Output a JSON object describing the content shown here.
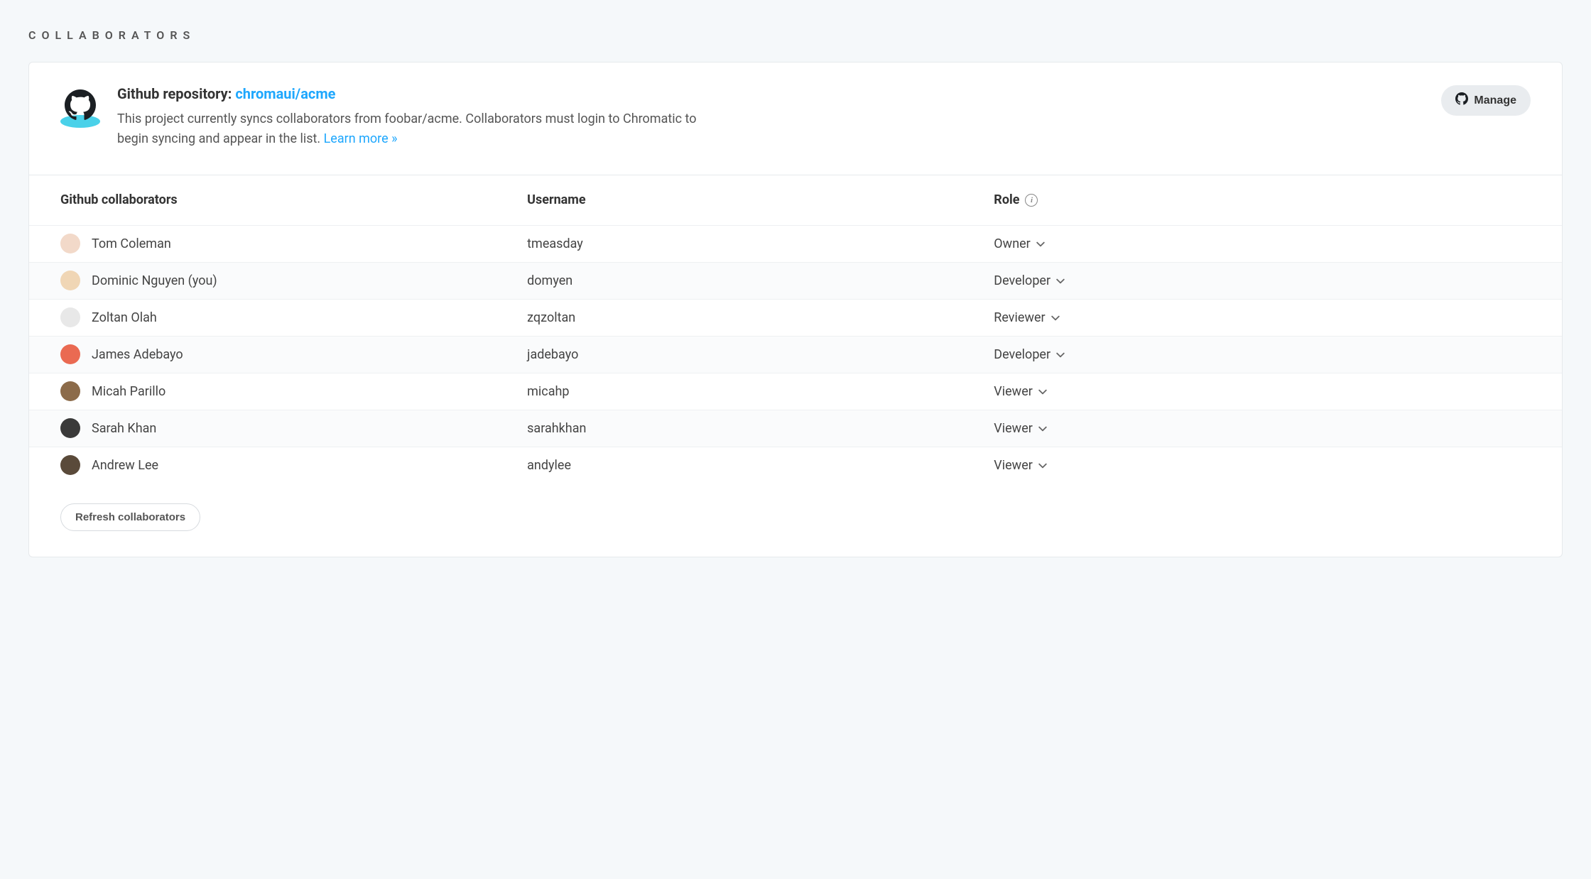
{
  "section_title": "Collaborators",
  "header": {
    "title_prefix": "Github repository: ",
    "repo_link_text": "chromaui/acme",
    "description_before_link": "This project currently syncs collaborators from foobar/acme. Collaborators must login to Chromatic to begin syncing and appear in the list. ",
    "learn_more_text": "Learn more »",
    "manage_button_label": "Manage"
  },
  "table": {
    "columns": {
      "name": "Github collaborators",
      "username": "Username",
      "role": "Role"
    },
    "rows": [
      {
        "name": "Tom Coleman",
        "username": "tmeasday",
        "role": "Owner",
        "avatar_bg": "#f2d9c9"
      },
      {
        "name": "Dominic Nguyen (you)",
        "username": "domyen",
        "role": "Developer",
        "avatar_bg": "#f0d6b5"
      },
      {
        "name": "Zoltan Olah",
        "username": "zqzoltan",
        "role": "Reviewer",
        "avatar_bg": "#e8e8e8"
      },
      {
        "name": "James Adebayo",
        "username": "jadebayo",
        "role": "Developer",
        "avatar_bg": "#ea6a52"
      },
      {
        "name": "Micah Parillo",
        "username": "micahp",
        "role": "Viewer",
        "avatar_bg": "#8c6b4a"
      },
      {
        "name": "Sarah Khan",
        "username": "sarahkhan",
        "role": "Viewer",
        "avatar_bg": "#3a3a3a"
      },
      {
        "name": "Andrew Lee",
        "username": "andylee",
        "role": "Viewer",
        "avatar_bg": "#5a4a3a"
      }
    ]
  },
  "footer": {
    "refresh_button_label": "Refresh collaborators"
  }
}
